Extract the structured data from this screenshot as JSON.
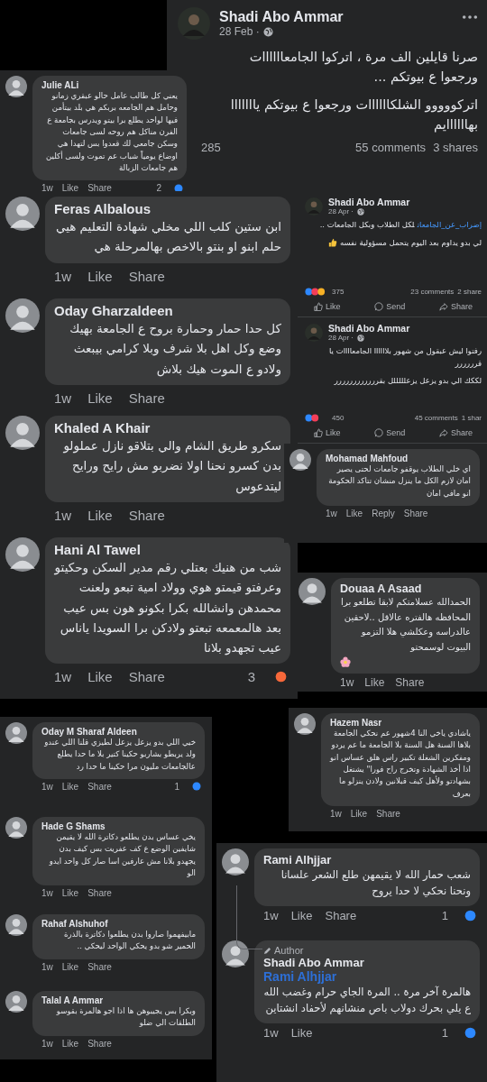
{
  "main_post": {
    "author": "Shadi Abo Ammar",
    "date": "28 Feb ·",
    "paragraphs": [
      "صرنا قايلين الف مرة ، اتركوا الجامعاااااات ورجعوا ع بيوتكم ...",
      "اتركووووو الشلكاااااات ورجعوا ع بيوتكم يااااااا بهاااااايم"
    ],
    "reaction_count": "285",
    "comments": "55 comments",
    "shares": "3 shares"
  },
  "shared_posts": [
    {
      "author": "Shadi Abo Ammar",
      "date": "28 Apr ·",
      "hashtag": "إضراب_عن_الجامعات",
      "paragraphs": [
        "لكل الطلاب وبكل الجامعات ..",
        "لي بدو يداوم بعد اليوم يتحمل مسؤولية نفسه"
      ],
      "reaction_count": "375",
      "comments": "23 comments",
      "shares": "2 share",
      "like": "Like",
      "send": "Send",
      "share": "Share"
    },
    {
      "author": "Shadi Abo Ammar",
      "date": "28 Apr ·",
      "paragraphs": [
        "رفتوا ليش عبقول من شهور بلاااااا الجامعاااات يا قرررررر",
        "لككك الي بدو يزعل يزعلللللل بقرررررررررررر"
      ],
      "reaction_count": "450",
      "comments": "45 comments",
      "shares": "1 shar",
      "like": "Like",
      "send": "Send",
      "share": "Share"
    }
  ],
  "comments": [
    {
      "author": "Julie ALi",
      "text": "يعني كل طالب عامل حالو عبقري زمانو وحامل هم الجامعه بربكم هي بلد بيتأمن فيها لواحد يطلع برا بيتو ويدرس بجامعة ع الفرن مناكل هم روحه لسى جامعات وسكن جامعي لك قعدوا بس لتهدا هي اوضاع يومياً شباب عم تموت ولسى أكلين هم جامعات الزبالة",
      "time": "1w",
      "like": "Like",
      "share": "Share",
      "reaction_count": "2"
    },
    {
      "author": "Feras Albalous",
      "text": "ابن ستين كلب اللي مخلي شهادة التعليم هيي حلم ابنو او بنتو بالاخص بهالمرحلة هي",
      "time": "1w",
      "like": "Like",
      "share": "Share"
    },
    {
      "author": "Oday Gharzaldeen",
      "text": "كل حدا حمار وحمارة بروح ع الجامعة بهيك وضع وكل اهل بلا شرف وبلا كرامي بيبعث ولادو ع الموت هيك بلاش",
      "time": "1w",
      "like": "Like",
      "share": "Share"
    },
    {
      "author": "Khaled A Khair",
      "text": "سكرو طريق الشام والي بتلاقو نازل عملولو بدن كسرو نحنا اولا نضربو مش رايح ورايح ليتدعوس",
      "time": "1w",
      "like": "Like",
      "share": "Share"
    },
    {
      "author": "Hani Al Tawel",
      "text": "شب من هنيك بعتلي رقم مدير السكن وحكيتو وعرفتو قيمتو هوي وولاد امية تبعو ولعنت محمدهن وانشالله بكرا بكونو هون بس عيب بعد هالمعمعه تبعتو ولادكن برا السويدا ياناس عيب تجهدو بلانا",
      "time": "1w",
      "like": "Like",
      "share": "Share",
      "reaction_count": "3"
    },
    {
      "author": "Mohamad Mahfoud",
      "text": "اي خلي الطلاب يوقفو جامعات لحتى يصير امان لازم الكل ما ينزل منشان تتاكد الحكومة انو مافي امان",
      "time": "1w",
      "like": "Like",
      "reply": "Reply",
      "share": "Share"
    },
    {
      "author": "Douaa A Asaad",
      "text": "الحمدالله عسلامتكم لابقا تطلعو برا المحافظه هالفتره عالاقل ..لاحقين عالدراسه وعكلشي هلا التزمو البيوت لوسمحتو",
      "time": "1w",
      "like": "Like",
      "share": "Share"
    },
    {
      "author": "Oday M Sharaf Aldeen",
      "text": "خيي اللي بدو يزعل يزعل لطيزي قلنا اللي عندو ولد يربطو بشاربو حكينا كتير بلا ما حدا يطلع عالجامعات مليون مرا حكينا ما حدا رد",
      "time": "1w",
      "like": "Like",
      "share": "Share",
      "reaction_count": "1"
    },
    {
      "author": "Hade G Shams",
      "text": "يخي عساس بدن يطلعو دكاترة الله لا يقيمن شايفين الوضع ع كف عفريت بس كيف بدن يجهدو بلانا مش عارفين اسا صار كل واحد ايدو الو",
      "time": "1w",
      "like": "Like",
      "share": "Share"
    },
    {
      "author": "Rahaf Alshuhof",
      "text": "مابيفهموا صاروا بدن يطلعوا دكاترة بالذرة الحمير  شو بدو يحكي الواحد ليحكي ..",
      "time": "1w",
      "like": "Like",
      "share": "Share"
    },
    {
      "author": "Talal A Ammar",
      "text": "وبكرا بس يجيبوهن ها اذا اجو هالمرة بقوسو الطلقات الي ضلو",
      "time": "1w",
      "like": "Like",
      "share": "Share"
    },
    {
      "author": "Hazem Nasr",
      "text": "ياشادي ياخي النا 4شهور عم نحكي الجامعة بلاها السنة هل السنة بلا الجامعة ما عم يردو ومفكرين الشغلة تكبير راس هلق عساس انو اذا أخذ الشهادة وتخرج راح فورا\" يشتغل بشهادتو ولأهل كيف قبلانين ولادن ينزلو ما بعرف",
      "time": "1w",
      "like": "Like",
      "share": "Share"
    },
    {
      "author": "Rami Alhjjar",
      "text": "شعب حمار الله لا يقيمهن طلع الشعر علسانا ونحنا نحكي لا حدا يروح",
      "time": "1w",
      "like": "Like",
      "share": "Share",
      "reaction_count": "1"
    },
    {
      "author": "Shadi Abo Ammar",
      "badge": "Author",
      "mention": "Rami Alhjjar",
      "text": "هالمرة آخر مرة .. المرة الجاي حرام وغضب الله ع يلي بحرك دولاب باص منشانهم لأحفاد انشتاين",
      "time": "1w",
      "like": "Like",
      "reaction_count": "1"
    }
  ]
}
